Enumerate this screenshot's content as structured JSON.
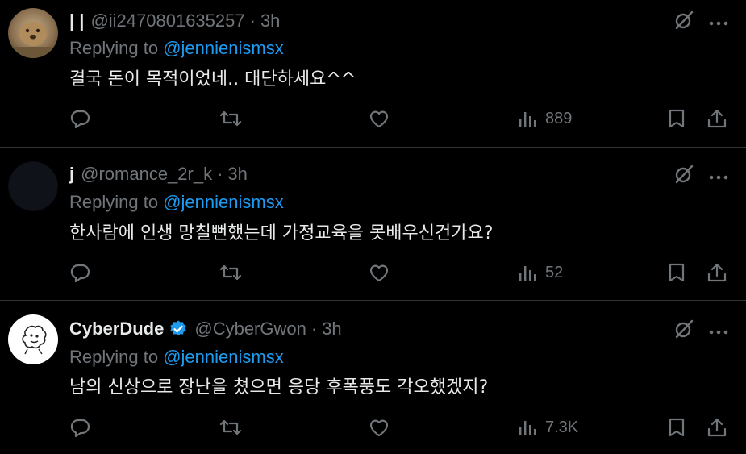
{
  "colors": {
    "background": "#000000",
    "text": "#e7e9ea",
    "muted": "#71767b",
    "link": "#1d9bf0",
    "divider": "#2f3336",
    "verified": "#1d9bf0"
  },
  "tweets": [
    {
      "name": "| |",
      "handle": "@ii2470801635257",
      "separator": "·",
      "time": "3h",
      "verified": false,
      "replying_prefix": "Replying to",
      "replying_to": "@jennienismsx",
      "text": "결국 돈이 목적이었네.. 대단하세요^^",
      "views": "889",
      "icons": [
        "reply-icon",
        "retweet-icon",
        "like-icon",
        "views-icon",
        "bookmark-icon",
        "share-icon",
        "grok-icon",
        "more-icon"
      ]
    },
    {
      "name": "j",
      "handle": "@romance_2r_k",
      "separator": "·",
      "time": "3h",
      "verified": false,
      "replying_prefix": "Replying to",
      "replying_to": "@jennienismsx",
      "text": "한사람에 인생 망칠뻔했는데  가정교육을 못배우신건가요?",
      "views": "52"
    },
    {
      "name": "CyberDude",
      "handle": "@CyberGwon",
      "separator": "·",
      "time": "3h",
      "verified": true,
      "replying_prefix": "Replying to",
      "replying_to": "@jennienismsx",
      "text": "남의 신상으로 장난을 쳤으면 응당 후폭풍도 각오했겠지?",
      "views": "7.3K"
    }
  ]
}
